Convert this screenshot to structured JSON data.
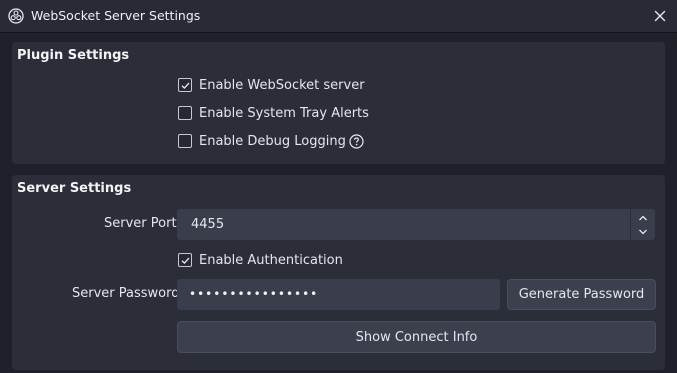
{
  "window": {
    "title": "WebSocket Server Settings",
    "app_icon": "obs-icon",
    "close_icon": "close-icon"
  },
  "plugin_settings": {
    "title": "Plugin Settings",
    "options": [
      {
        "label": "Enable WebSocket server",
        "checked": true
      },
      {
        "label": "Enable System Tray Alerts",
        "checked": false
      },
      {
        "label": "Enable Debug Logging",
        "checked": false,
        "help_icon": "help-icon"
      }
    ]
  },
  "server_settings": {
    "title": "Server Settings",
    "port_label": "Server Port",
    "port_value": "4455",
    "auth_label": "Enable Authentication",
    "auth_checked": true,
    "password_label": "Server Password",
    "password_value": "••••••••••••••••",
    "generate_label": "Generate Password",
    "connect_info_label": "Show Connect Info"
  },
  "colors": {
    "background": "#1f2029",
    "panel": "#2b2d38",
    "input": "#3a3d4b",
    "text": "#e6e6ec"
  }
}
